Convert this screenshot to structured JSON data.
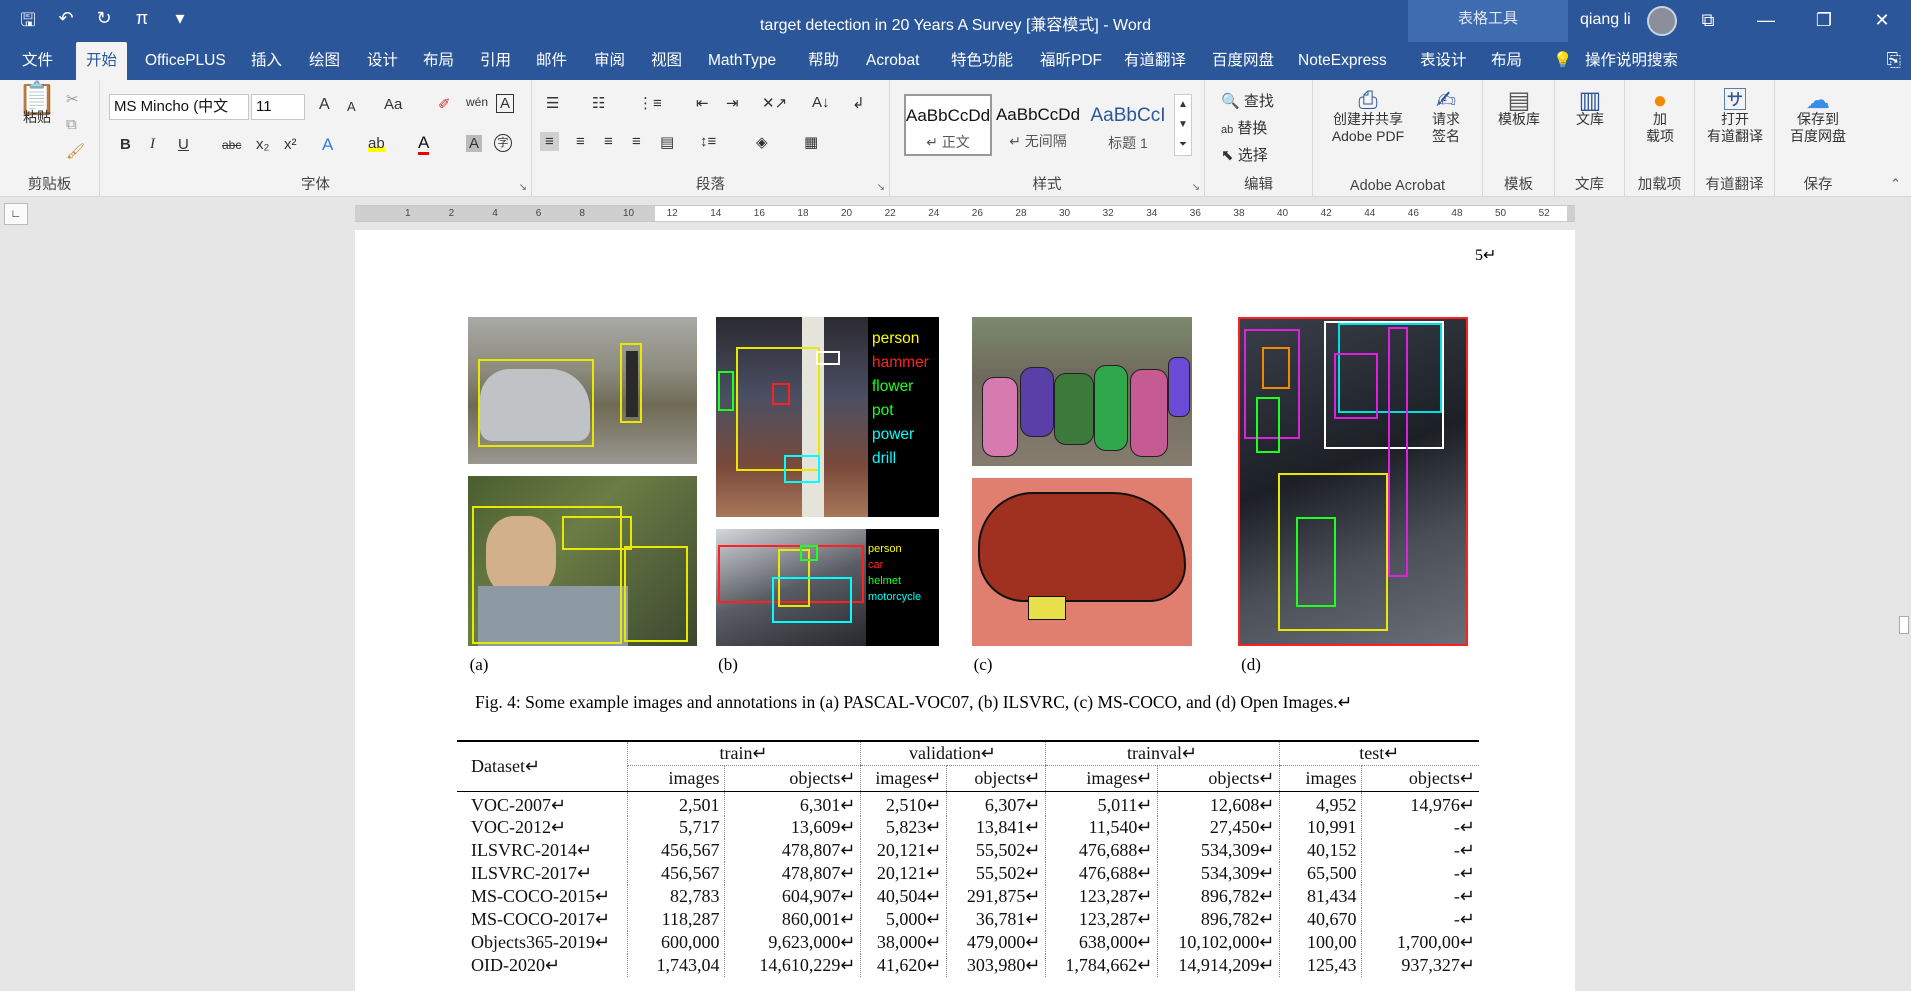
{
  "title_bar": {
    "doc_title": "target detection in 20 Years A Survey [兼容模式] - Word",
    "context_label": "表格工具",
    "user": "qiang li"
  },
  "qat": {
    "save": "🖫",
    "undo": "↶",
    "redo": "↻",
    "pi": "π",
    "customize": "▾"
  },
  "window_controls": {
    "ribbon_display": "⧉",
    "minimize": "—",
    "restore": "❐",
    "close": "✕"
  },
  "tabs": [
    "文件",
    "开始",
    "OfficePLUS",
    "插入",
    "绘图",
    "设计",
    "布局",
    "引用",
    "邮件",
    "审阅",
    "视图",
    "MathType",
    "帮助",
    "Acrobat",
    "特色功能",
    "福昕PDF",
    "有道翻译",
    "百度网盘",
    "NoteExpress",
    "表设计",
    "布局",
    "操作说明搜索"
  ],
  "ribbon": {
    "clipboard": {
      "paste": "粘贴",
      "label": "剪贴板"
    },
    "font": {
      "name": "MS Mincho (中文",
      "size": "11",
      "label": "字体",
      "bold": "B",
      "italic": "I",
      "underline": "U",
      "strike": "abc",
      "sub": "x₂",
      "sup": "x²",
      "grow": "A",
      "shrink": "A",
      "case": "Aa",
      "font_color": "A"
    },
    "paragraph": {
      "label": "段落"
    },
    "styles": {
      "items": [
        {
          "sample": "AaBbCcDd",
          "name": "↵ 正文"
        },
        {
          "sample": "AaBbCcDd",
          "name": "↵ 无间隔"
        },
        {
          "sample": "AaBbCcI",
          "name": "标题 1"
        }
      ],
      "label": "样式"
    },
    "editing": {
      "find": "查找",
      "replace": "替换",
      "select": "选择",
      "label": "编辑"
    },
    "acrobat": {
      "create_share": "创建并共享",
      "adobe_pdf": "Adobe PDF",
      "request": "请求",
      "sign": "签名",
      "label": "Adobe Acrobat"
    },
    "templates": {
      "btn": "模板库",
      "label": "模板"
    },
    "library": {
      "btn": "文库",
      "label": "文库"
    },
    "addins": {
      "btn1": "加",
      "btn2": "载项",
      "label": "加载项"
    },
    "youdao": {
      "btn1": "打开",
      "btn2": "有道翻译",
      "label": "有道翻译"
    },
    "baidu": {
      "btn1": "保存到",
      "btn2": "百度网盘",
      "label": "保存"
    }
  },
  "ruler": {
    "ticks": [
      "1",
      "2",
      "4",
      "6",
      "8",
      "10",
      "12",
      "14",
      "16",
      "18",
      "20",
      "22",
      "24",
      "26",
      "28",
      "30",
      "32",
      "34",
      "36",
      "38",
      "40",
      "42",
      "44",
      "46",
      "48",
      "50",
      "52"
    ]
  },
  "page": {
    "page_number": "5↵",
    "figure_letters": [
      "(a)",
      "(b)",
      "(c)",
      "(d)"
    ],
    "ilsvrc_labels": [
      {
        "text": "person",
        "color": "#ffff00"
      },
      {
        "text": "hammer",
        "color": "#ff2020"
      },
      {
        "text": "flower pot",
        "color": "#20ff20"
      },
      {
        "text": "power drill",
        "color": "#00ffff"
      }
    ],
    "ilsvrc_labels2": [
      {
        "text": "person",
        "color": "#ffff00"
      },
      {
        "text": "car",
        "color": "#ff2020"
      },
      {
        "text": "helmet",
        "color": "#20ff20"
      },
      {
        "text": "motorcycle",
        "color": "#00ffff"
      }
    ],
    "figure_caption": "Fig. 4: Some example images and annotations in (a) PASCAL-VOC07, (b) ILSVRC, (c) MS-COCO, and (d) Open Images.↵",
    "table": {
      "dataset_header": "Dataset↵",
      "groups": [
        "train↵",
        "validation↵",
        "trainval↵",
        "test↵"
      ],
      "subheaders": [
        "images",
        "objects↵",
        "images↵",
        "objects↵",
        "images↵",
        "objects↵",
        "images",
        "objects↵"
      ],
      "rows": [
        [
          "VOC-2007↵",
          "2,501",
          "6,301↵",
          "2,510↵",
          "6,307↵",
          "5,011↵",
          "12,608↵",
          "4,952",
          "14,976↵"
        ],
        [
          "VOC-2012↵",
          "5,717",
          "13,609↵",
          "5,823↵",
          "13,841↵",
          "11,540↵",
          "27,450↵",
          "10,991",
          "-↵"
        ],
        [
          "ILSVRC-2014↵",
          "456,567",
          "478,807↵",
          "20,121↵",
          "55,502↵",
          "476,688↵",
          "534,309↵",
          "40,152",
          "-↵"
        ],
        [
          "ILSVRC-2017↵",
          "456,567",
          "478,807↵",
          "20,121↵",
          "55,502↵",
          "476,688↵",
          "534,309↵",
          "65,500",
          "-↵"
        ],
        [
          "MS-COCO-2015↵",
          "82,783",
          "604,907↵",
          "40,504↵",
          "291,875↵",
          "123,287↵",
          "896,782↵",
          "81,434",
          "-↵"
        ],
        [
          "MS-COCO-2017↵",
          "118,287",
          "860,001↵",
          "5,000↵",
          "36,781↵",
          "123,287↵",
          "896,782↵",
          "40,670",
          "-↵"
        ],
        [
          "Objects365-2019↵",
          "600,000",
          "9,623,000↵",
          "38,000↵",
          "479,000↵",
          "638,000↵",
          "10,102,000↵",
          "100,00",
          "1,700,00↵"
        ],
        [
          "OID-2020↵",
          "1,743,04",
          "14,610,229↵",
          "41,620↵",
          "303,980↵",
          "1,784,662↵",
          "14,914,209↵",
          "125,43",
          "937,327↵"
        ]
      ]
    }
  }
}
